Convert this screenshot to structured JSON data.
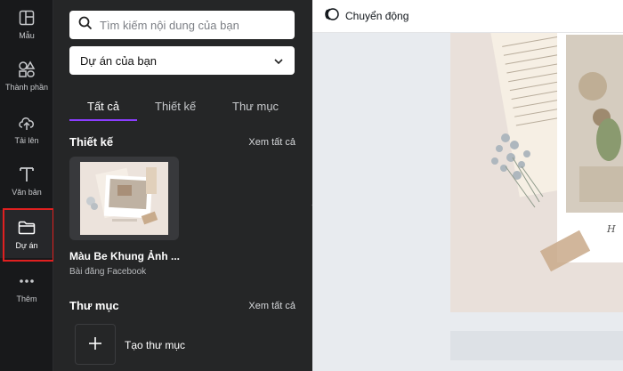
{
  "rail": {
    "items": [
      {
        "label": "Mẫu",
        "icon": "template-icon"
      },
      {
        "label": "Thành phần",
        "icon": "elements-icon"
      },
      {
        "label": "Tải lên",
        "icon": "upload-icon"
      },
      {
        "label": "Văn bản",
        "icon": "text-icon"
      },
      {
        "label": "Dự án",
        "icon": "folder-icon"
      },
      {
        "label": "Thêm",
        "icon": "more-icon"
      }
    ]
  },
  "panel": {
    "search_placeholder": "Tìm kiếm nội dung của bạn",
    "project_select": "Dự án của bạn",
    "tabs": [
      {
        "label": "Tất cả"
      },
      {
        "label": "Thiết kế"
      },
      {
        "label": "Thư mục"
      }
    ],
    "designs_section": {
      "title": "Thiết kế",
      "see_all": "Xem tất cả"
    },
    "design": {
      "name": "Màu Be Khung Ảnh ...",
      "type": "Bài đăng Facebook"
    },
    "folders_section": {
      "title": "Thư mục",
      "see_all": "Xem tất cả"
    },
    "new_folder_label": "Tạo thư mục"
  },
  "topbar": {
    "animate_label": "Chuyển động"
  }
}
